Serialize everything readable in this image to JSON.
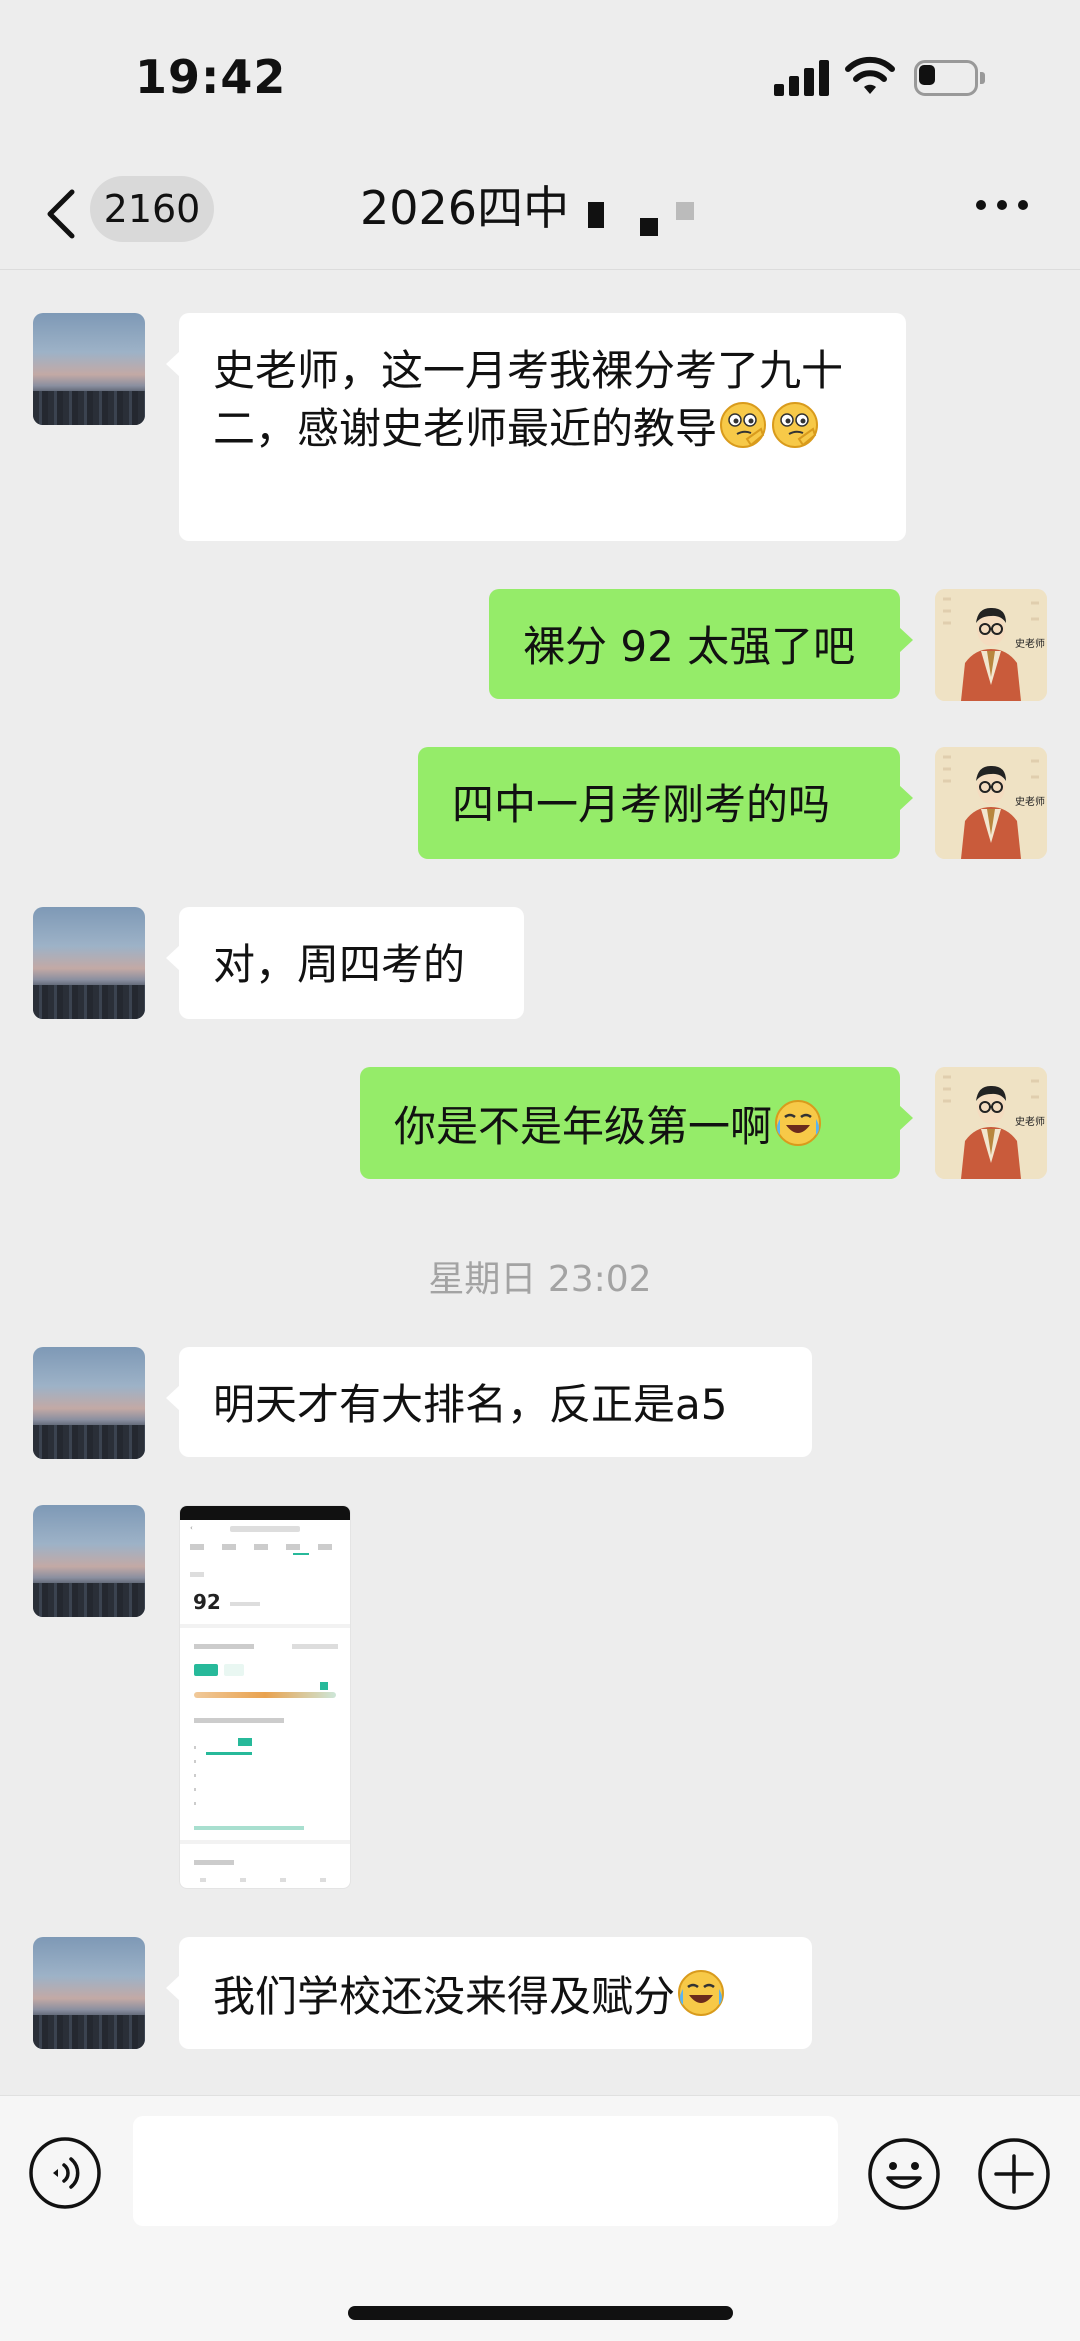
{
  "status_bar": {
    "time": "19:42",
    "battery_level": 0.3
  },
  "nav": {
    "unread_count": "2160",
    "title": "2026四中"
  },
  "messages": [
    {
      "side": "left",
      "text": "史老师，这一月考我裸分考了九十二，感谢史老师最近的教导",
      "emoji": [
        "thinking-face-emoji",
        "thinking-face-emoji"
      ]
    },
    {
      "side": "right",
      "text": "裸分 92 太强了吧"
    },
    {
      "side": "right",
      "text": "四中一月考刚考的吗"
    },
    {
      "side": "left",
      "text": "对，周四考的"
    },
    {
      "side": "right",
      "text": "你是不是年级第一啊",
      "emoji": [
        "crying-laughing-emoji"
      ]
    },
    {
      "side": "left",
      "text": "明天才有大排名，反正是a5"
    },
    {
      "side": "left",
      "type": "image",
      "score": "92"
    },
    {
      "side": "left",
      "text": "我们学校还没来得及赋分",
      "emoji": [
        "crying-laughing-emoji"
      ]
    }
  ],
  "timestamp": "星期日 23:02",
  "teacher_avatar_label": "史老师",
  "colors": {
    "background": "#ededed",
    "my_bubble": "#95ec69",
    "their_bubble": "#ffffff",
    "timestamp": "#a3a3a3"
  },
  "input_bar": {
    "placeholder": ""
  }
}
